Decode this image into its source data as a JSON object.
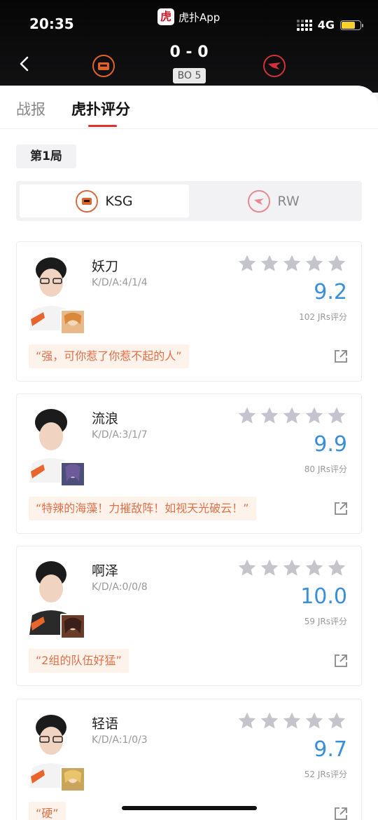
{
  "status_bar": {
    "time": "20:35",
    "app_name": "虎扑App",
    "app_logo_char": "虎",
    "network": "4G"
  },
  "match": {
    "score": "0 - 0",
    "format": "BO 5"
  },
  "tabs": [
    {
      "label": "战报"
    },
    {
      "label": "虎扑评分"
    }
  ],
  "round_label": "第1局",
  "teams": [
    {
      "name": "KSG"
    },
    {
      "name": "RW"
    }
  ],
  "players": [
    {
      "name": "妖刀",
      "kda": "K/D/A:4/1/4",
      "score": "9.2",
      "votes": "102 JRs评分",
      "quote": "“强，可你惹了你惹不起的人”"
    },
    {
      "name": "流浪",
      "kda": "K/D/A:3/1/7",
      "score": "9.9",
      "votes": "80 JRs评分",
      "quote": "“特辣的海藻！力摧敌阵！如视天光破云！”"
    },
    {
      "name": "啊泽",
      "kda": "K/D/A:0/0/8",
      "score": "10.0",
      "votes": "59 JRs评分",
      "quote": "“2组的队伍好猛”"
    },
    {
      "name": "轻语",
      "kda": "K/D/A:1/0/3",
      "score": "9.7",
      "votes": "52 JRs评分",
      "quote": "“硬”"
    }
  ],
  "colors": {
    "accent_red": "#e0312b",
    "score_blue": "#3a8fd9",
    "quote_orange": "#e0704a"
  }
}
